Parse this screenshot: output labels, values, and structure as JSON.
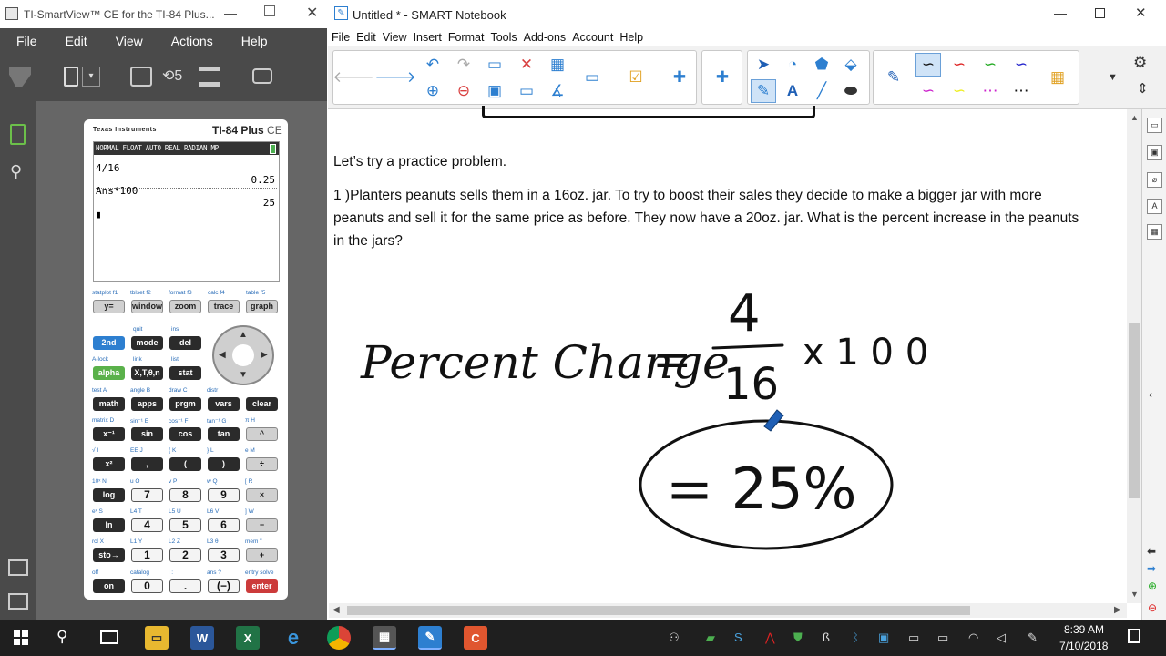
{
  "ti": {
    "title": "TI-SmartView™ CE for the TI-84 Plus...",
    "menu": [
      "File",
      "Edit",
      "View",
      "Actions",
      "Help"
    ],
    "brand": "Texas Instruments",
    "model": "TI-84 Plus",
    "model_suffix": "CE",
    "status_bar": "NORMAL FLOAT AUTO REAL RADIAN MP",
    "history": [
      {
        "expr": "4/16",
        "result": "0.25"
      },
      {
        "expr": "Ans*100",
        "result": "25"
      }
    ],
    "cursor": "▮",
    "fkey_labels": [
      "statplot f1",
      "tblset f2",
      "format f3",
      "calc f4",
      "table f5"
    ],
    "fkeys": [
      "y=",
      "window",
      "zoom",
      "trace",
      "graph"
    ],
    "row2_labels": [
      "quit",
      "ins"
    ],
    "row2": [
      "2nd",
      "mode",
      "del"
    ],
    "row3_labels": [
      "A-lock",
      "link",
      "list"
    ],
    "row3": [
      "alpha",
      "X,T,θ,n",
      "stat"
    ],
    "row4_labels": [
      "test A",
      "angle B",
      "draw C",
      "distr"
    ],
    "row4": [
      "math",
      "apps",
      "prgm",
      "vars",
      "clear"
    ],
    "row5_labels": [
      "matrix D",
      "sin⁻¹ E",
      "cos⁻¹ F",
      "tan⁻¹ G",
      "π H"
    ],
    "row5": [
      "x⁻¹",
      "sin",
      "cos",
      "tan",
      "^"
    ],
    "row6_labels": [
      "√ I",
      "EE J",
      "{ K",
      "} L",
      "e M"
    ],
    "row6": [
      "x²",
      ",",
      "(",
      ")",
      "÷"
    ],
    "row7_labels": [
      "10ˣ N",
      "u O",
      "v P",
      "w Q",
      "[ R"
    ],
    "row7": [
      "log",
      "7",
      "8",
      "9",
      "×"
    ],
    "row8_labels": [
      "eˣ S",
      "L4 T",
      "L5 U",
      "L6 V",
      "] W"
    ],
    "row8": [
      "ln",
      "4",
      "5",
      "6",
      "−"
    ],
    "row9_labels": [
      "rcl X",
      "L1 Y",
      "L2 Z",
      "L3 θ",
      "mem \""
    ],
    "row9": [
      "sto→",
      "1",
      "2",
      "3",
      "+"
    ],
    "row10_labels": [
      "off",
      "catalog",
      "i :",
      "ans ?",
      "entry solve"
    ],
    "row10": [
      "on",
      "0",
      ".",
      "(−)",
      "enter"
    ]
  },
  "smart": {
    "title": "Untitled * - SMART Notebook",
    "menu": [
      "File",
      "Edit",
      "View",
      "Insert",
      "Format",
      "Tools",
      "Add-ons",
      "Account",
      "Help"
    ],
    "prompt": "Let’s try a practice problem.",
    "problem": "1 )Planters peanuts sells them in a 16oz. jar. To try to boost their sales they decide to make a bigger jar with more peanuts and sell it for the same price as before. They now have a 20oz. jar. What is the percent increase in the peanuts in the jars?",
    "handwriting": {
      "label": "Percent Change",
      "numerator": "4",
      "denominator": "16",
      "multiplier": "x 1 0 0",
      "answer": "= 25%"
    }
  },
  "taskbar": {
    "time": "8:39 AM",
    "date": "7/10/2018"
  },
  "colors": {
    "ti_dark": "#4a4a4a",
    "ti_green": "#5ab14a",
    "smart_blue": "#2d7fd0",
    "pen_blue": "#1f5fb5"
  }
}
